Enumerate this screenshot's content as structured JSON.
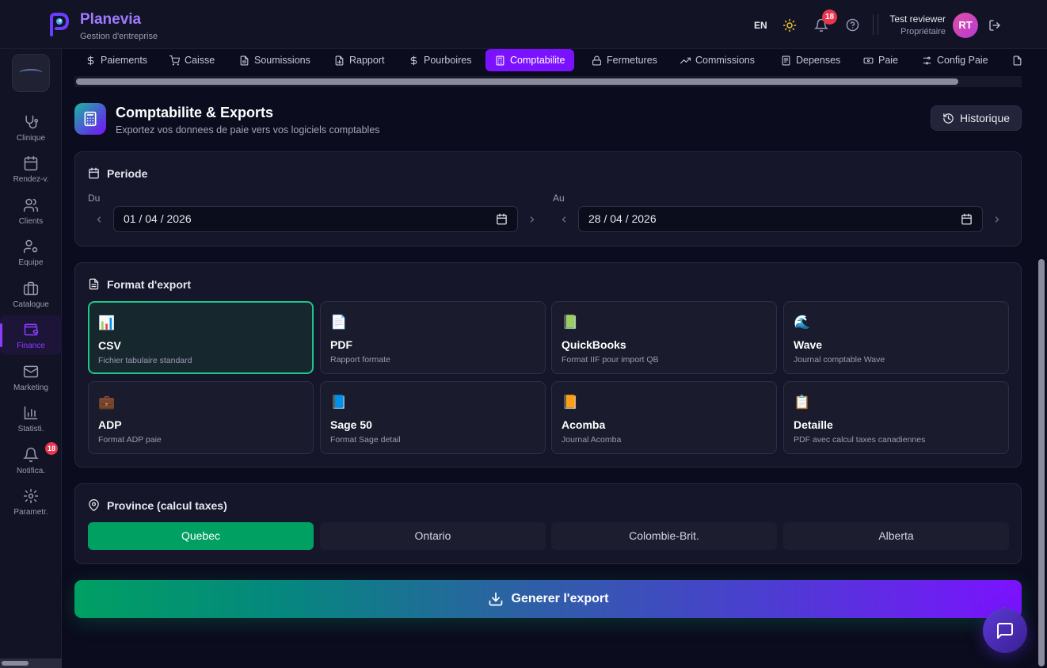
{
  "brand": {
    "name": "Planevia",
    "subtitle": "Gestion d'entreprise"
  },
  "topbar": {
    "language": "EN",
    "notifications_count": "18",
    "user_name": "Test reviewer",
    "user_role": "Propriétaire",
    "avatar_initials": "RT"
  },
  "sidebar": {
    "items": [
      {
        "label": "Clinique",
        "icon": "stethoscope-icon"
      },
      {
        "label": "Rendez-v.",
        "icon": "calendar-icon"
      },
      {
        "label": "Clients",
        "icon": "users-icon"
      },
      {
        "label": "Equipe",
        "icon": "user-cog-icon"
      },
      {
        "label": "Catalogue",
        "icon": "briefcase-icon"
      },
      {
        "label": "Finance",
        "icon": "wallet-icon",
        "active": true
      },
      {
        "label": "Marketing",
        "icon": "mail-icon"
      },
      {
        "label": "Statisti.",
        "icon": "bar-chart-icon"
      },
      {
        "label": "Notifica.",
        "icon": "bell-icon",
        "badge": "18"
      },
      {
        "label": "Parametr.",
        "icon": "gear-icon"
      }
    ]
  },
  "tabs": [
    {
      "label": "Paiements",
      "icon": "dollar-icon"
    },
    {
      "label": "Caisse",
      "icon": "cart-icon"
    },
    {
      "label": "Soumissions",
      "icon": "file-icon"
    },
    {
      "label": "Rapport",
      "icon": "file-chart-icon"
    },
    {
      "label": "Pourboires",
      "icon": "dollar-icon"
    },
    {
      "label": "Comptabilite",
      "icon": "calculator-icon",
      "active": true
    },
    {
      "label": "Fermetures",
      "icon": "lock-icon"
    },
    {
      "label": "Commissions",
      "icon": "trending-up-icon"
    },
    {
      "label": "Depenses",
      "icon": "receipt-icon"
    },
    {
      "label": "Paie",
      "icon": "banknote-icon"
    },
    {
      "label": "Config Paie",
      "icon": "settings-icon"
    }
  ],
  "header": {
    "title": "Comptabilite & Exports",
    "subtitle": "Exportez vos donnees de paie vers vos logiciels comptables",
    "history_button": "Historique"
  },
  "period": {
    "title": "Periode",
    "from_label": "Du",
    "from_value": "01 / 04 / 2026",
    "to_label": "Au",
    "to_value": "28 / 04 / 2026"
  },
  "export_format": {
    "title": "Format d'export",
    "options": [
      {
        "emoji": "📊",
        "name": "CSV",
        "description": "Fichier tabulaire standard",
        "selected": true
      },
      {
        "emoji": "📄",
        "name": "PDF",
        "description": "Rapport formate"
      },
      {
        "emoji": "📗",
        "name": "QuickBooks",
        "description": "Format IIF pour import QB"
      },
      {
        "emoji": "🌊",
        "name": "Wave",
        "description": "Journal comptable Wave"
      },
      {
        "emoji": "💼",
        "name": "ADP",
        "description": "Format ADP paie"
      },
      {
        "emoji": "📘",
        "name": "Sage 50",
        "description": "Format Sage detail"
      },
      {
        "emoji": "📙",
        "name": "Acomba",
        "description": "Journal Acomba"
      },
      {
        "emoji": "📋",
        "name": "Detaille",
        "description": "PDF avec calcul taxes canadiennes"
      }
    ]
  },
  "province": {
    "title": "Province (calcul taxes)",
    "options": [
      {
        "label": "Quebec",
        "selected": true
      },
      {
        "label": "Ontario"
      },
      {
        "label": "Colombie-Brit."
      },
      {
        "label": "Alberta"
      }
    ]
  },
  "generate_button": "Generer l'export",
  "colors": {
    "accent_purple": "#7b12ff",
    "accent_green": "#00a063",
    "selected_border": "#1fc48b",
    "badge_red": "#e8364f"
  }
}
